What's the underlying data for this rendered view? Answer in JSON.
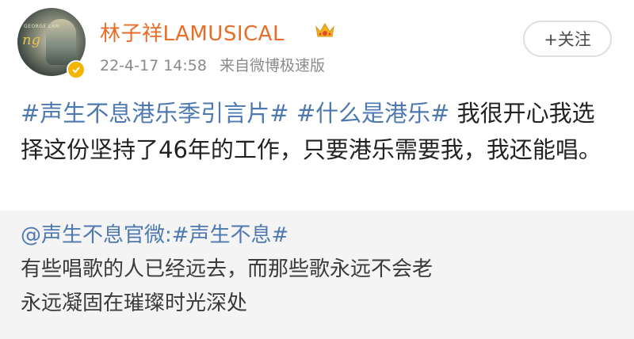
{
  "post": {
    "author": {
      "name": "林子祥LAMUSICAL",
      "avatar_label": "GEORGE LAM",
      "avatar_script": "ng"
    },
    "meta": {
      "timestamp": "22-4-17 14:58",
      "source": "来自微博极速版"
    },
    "follow_label": "+关注",
    "content": {
      "topic1": "#声生不息港乐季引言片#",
      "topic2": "#什么是港乐#",
      "text": "我很开心我选择这份坚持了46年的工作，只要港乐需要我，我还能唱。"
    }
  },
  "repost": {
    "author": "@声生不息官微:",
    "topic": "#声生不息#",
    "lines": [
      "有些唱歌的人已经远去，而那些歌永远不会老",
      "永远凝固在璀璨时光深处"
    ]
  },
  "colors": {
    "username": "#e86e27",
    "link": "#4d79b0",
    "verify": "#f4b400",
    "repost_bg": "#f4f4f4"
  },
  "icons": {
    "crown": "crown-icon",
    "verify": "verified-badge-icon"
  }
}
